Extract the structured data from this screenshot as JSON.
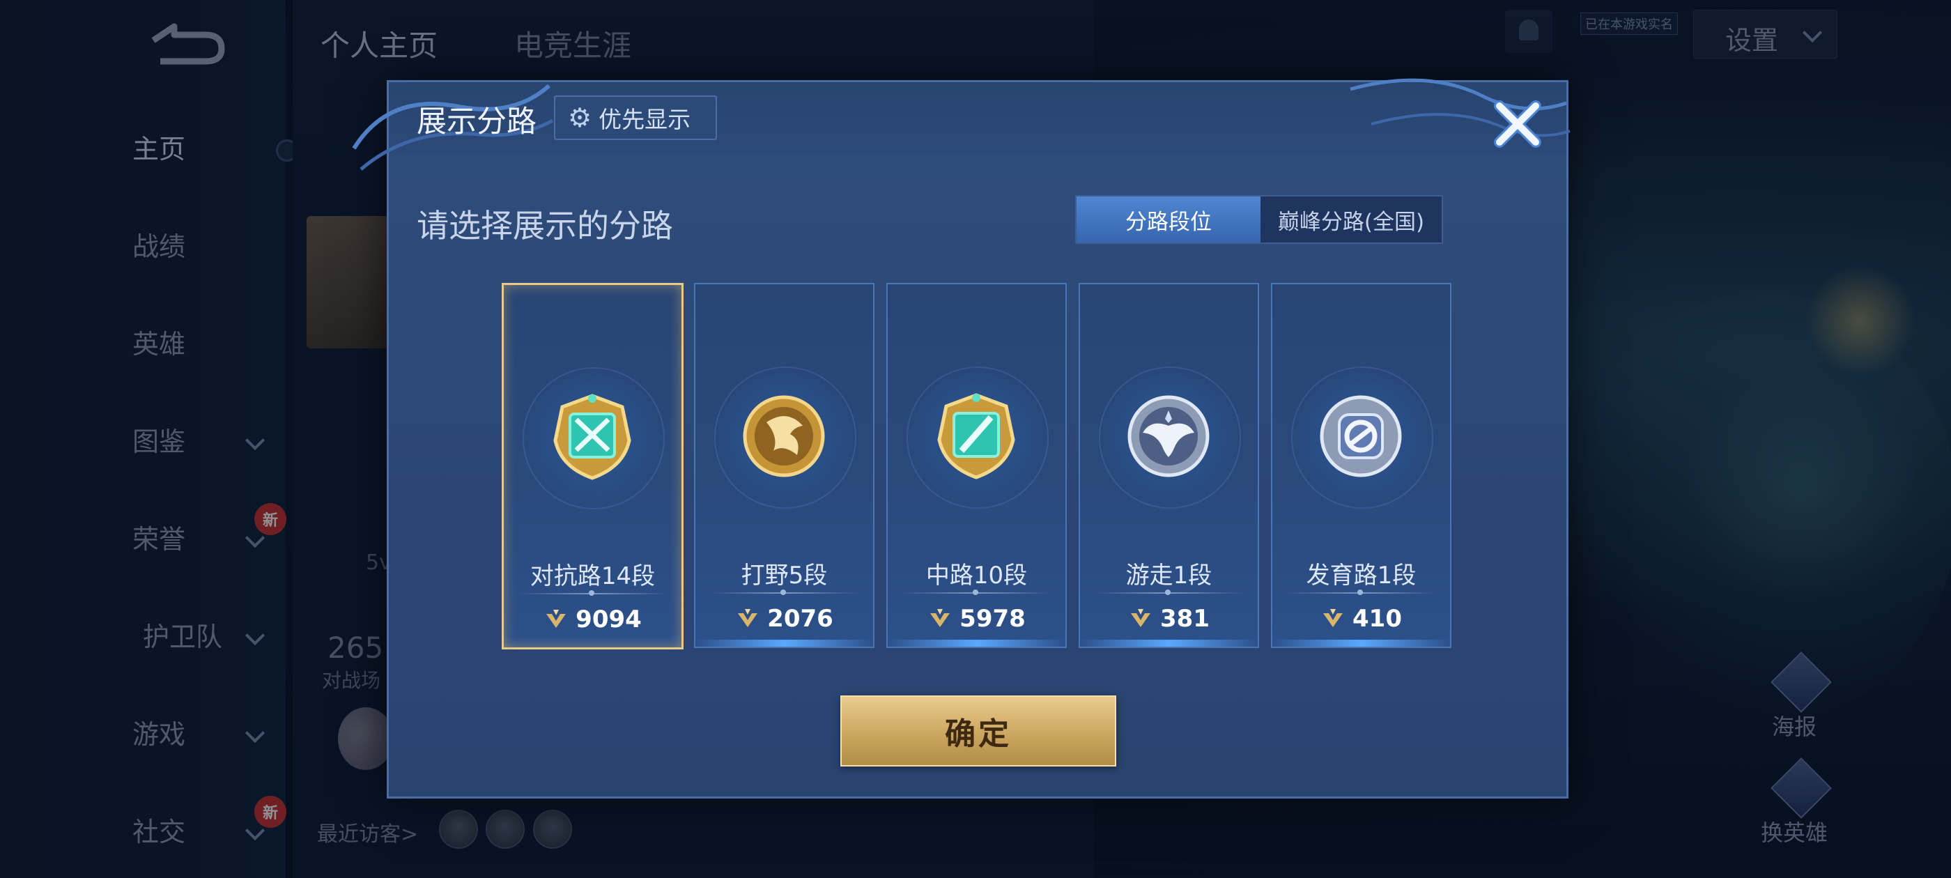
{
  "background": {
    "top_tabs": [
      "个人主页",
      "电竞生涯"
    ],
    "sidebar_items": [
      {
        "label": "主页",
        "has_dropdown": false,
        "is_new": false,
        "active": true
      },
      {
        "label": "战绩",
        "has_dropdown": false,
        "is_new": false,
        "active": false
      },
      {
        "label": "英雄",
        "has_dropdown": false,
        "is_new": false,
        "active": false
      },
      {
        "label": "图鉴",
        "has_dropdown": true,
        "is_new": false,
        "active": false
      },
      {
        "label": "荣誉",
        "has_dropdown": true,
        "is_new": true,
        "active": false
      },
      {
        "label": "护卫队",
        "has_dropdown": true,
        "is_new": false,
        "active": false
      },
      {
        "label": "游戏",
        "has_dropdown": true,
        "is_new": false,
        "active": false
      },
      {
        "label": "社交",
        "has_dropdown": true,
        "is_new": true,
        "active": false
      }
    ],
    "new_badge": "新",
    "settings_label": "设置",
    "realname_badge": "已在本游戏实名",
    "partial_number": "265",
    "partial_label": "对战场",
    "partial_small": "5v",
    "recent_visitors": "最近访客>",
    "right_buttons": [
      "海报",
      "换英雄"
    ]
  },
  "modal": {
    "title": "展示分路",
    "priority_button": "优先显示",
    "subtitle": "请选择展示的分路",
    "toggle": {
      "options": [
        "分路段位",
        "巅峰分路(全国)"
      ],
      "selected_index": 0
    },
    "cards": [
      {
        "label": "对抗路14段",
        "points": "9094",
        "emblem": "sword-gold-emblem",
        "selected": true
      },
      {
        "label": "打野5段",
        "points": "2076",
        "emblem": "dragon-gold-emblem",
        "selected": false
      },
      {
        "label": "中路10段",
        "points": "5978",
        "emblem": "staff-gold-emblem",
        "selected": false
      },
      {
        "label": "游走1段",
        "points": "381",
        "emblem": "wings-silver-emblem",
        "selected": false
      },
      {
        "label": "发育路1段",
        "points": "410",
        "emblem": "bow-silver-emblem",
        "selected": false
      }
    ],
    "confirm_button": "确定"
  },
  "colors": {
    "accent_gold": "#e9cc8e",
    "toggle_selected": "#4f86d2",
    "modal_bg": "#2f4d7c"
  }
}
